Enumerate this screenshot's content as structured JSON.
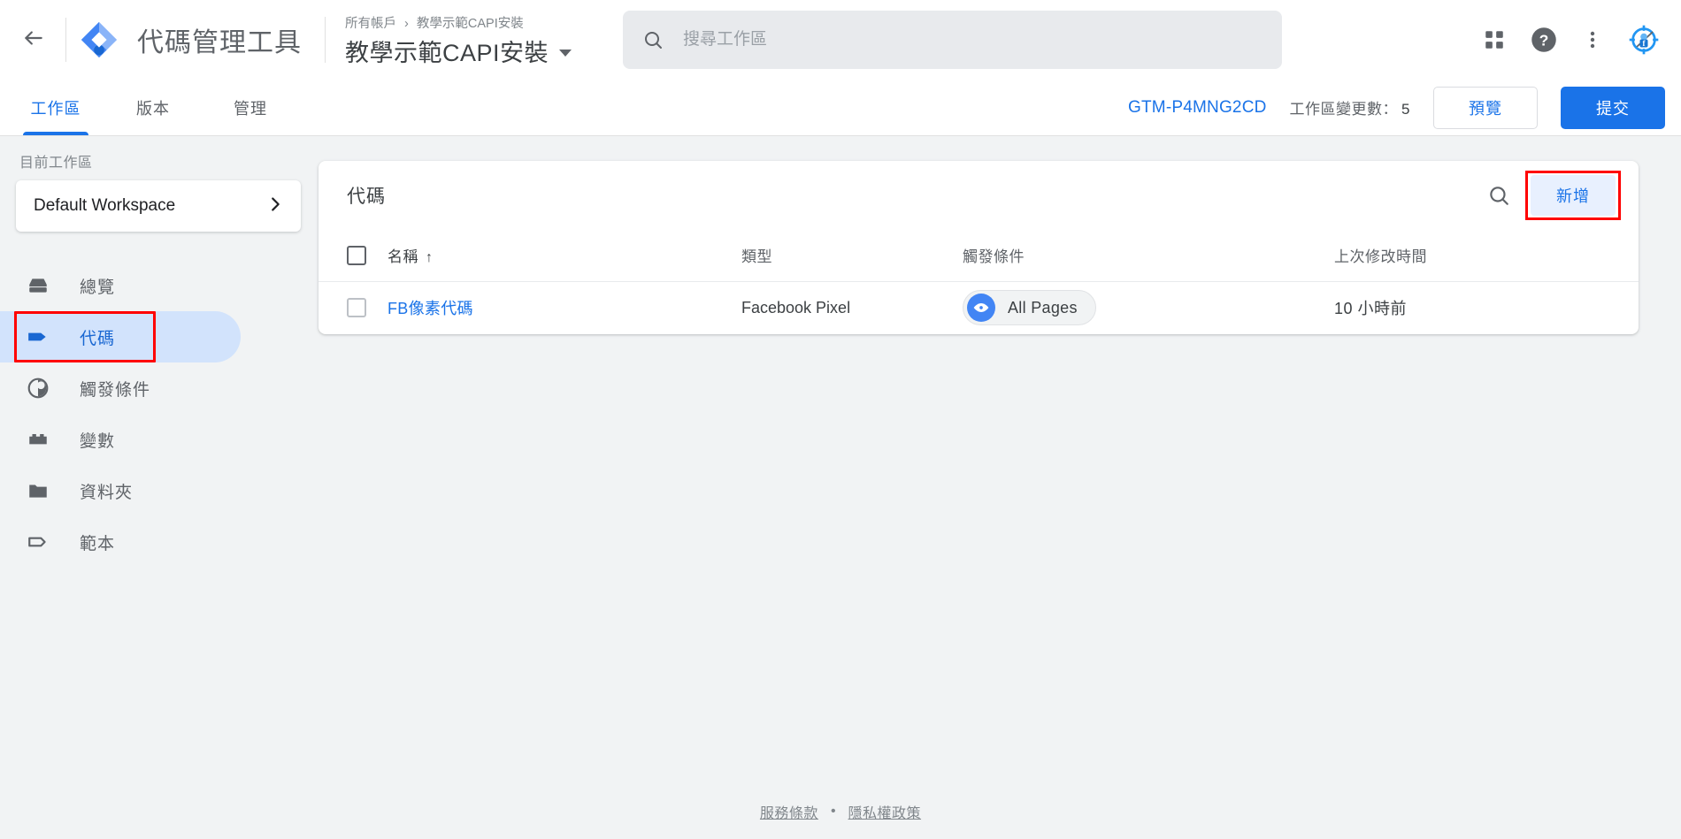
{
  "header": {
    "back_icon": "arrow-left-icon",
    "logo_icon": "gtm-logo-icon",
    "product_title": "代碼管理工具",
    "breadcrumb_account": "所有帳戶",
    "breadcrumb_separator": "›",
    "breadcrumb_container": "教學示範CAPI安裝",
    "container_name": "教學示範CAPI安裝",
    "search": {
      "icon": "search-icon",
      "value": "",
      "placeholder": "搜尋工作區"
    },
    "actions": [
      {
        "name": "apps-grid-icon",
        "label": "Google 應用程式"
      },
      {
        "name": "help-icon",
        "label": "說明"
      },
      {
        "name": "more-vert-icon",
        "label": "更多選項"
      },
      {
        "name": "facebook-pixel-helper-icon",
        "label": "Facebook Pixel Helper"
      }
    ]
  },
  "tabbar": {
    "tabs": [
      {
        "label": "工作區",
        "active": true
      },
      {
        "label": "版本",
        "active": false
      },
      {
        "label": "管理",
        "active": false
      }
    ],
    "container_id": "GTM-P4MNG2CD",
    "changes_label": "工作區變更數：",
    "changes_count": "5",
    "preview_label": "預覽",
    "submit_label": "提交"
  },
  "sidebar": {
    "current_workspace_label": "目前工作區",
    "workspace_name": "Default Workspace",
    "workspace_chevron_icon": "chevron-right-icon",
    "items": [
      {
        "label": "總覽",
        "icon": "overview-icon",
        "selected": false
      },
      {
        "label": "代碼",
        "icon": "tag-icon",
        "selected": true
      },
      {
        "label": "觸發條件",
        "icon": "trigger-icon",
        "selected": false
      },
      {
        "label": "變數",
        "icon": "variable-icon",
        "selected": false
      },
      {
        "label": "資料夾",
        "icon": "folder-icon",
        "selected": false
      },
      {
        "label": "範本",
        "icon": "template-icon",
        "selected": false
      }
    ]
  },
  "main": {
    "card_title": "代碼",
    "search_icon": "search-icon",
    "add_button_label": "新增",
    "table": {
      "columns": [
        {
          "key": "checkbox",
          "label": ""
        },
        {
          "key": "name",
          "label": "名稱",
          "sort": "↑"
        },
        {
          "key": "type",
          "label": "類型"
        },
        {
          "key": "trigger",
          "label": "觸發條件"
        },
        {
          "key": "modified",
          "label": "上次修改時間"
        }
      ],
      "rows": [
        {
          "name": "FB像素代碼",
          "type": "Facebook Pixel",
          "trigger": {
            "label": "All Pages",
            "icon": "eye-icon"
          },
          "modified": "10 小時前"
        }
      ]
    }
  },
  "footer": {
    "terms_label": "服務條款",
    "separator": "•",
    "privacy_label": "隱私權政策"
  },
  "colors": {
    "accent_blue": "#1a73e8",
    "selected_pill": "#d2e3fc",
    "page_bg": "#f1f3f4",
    "annotation_red": "#ff0000",
    "chip_blue": "#4285f4"
  }
}
